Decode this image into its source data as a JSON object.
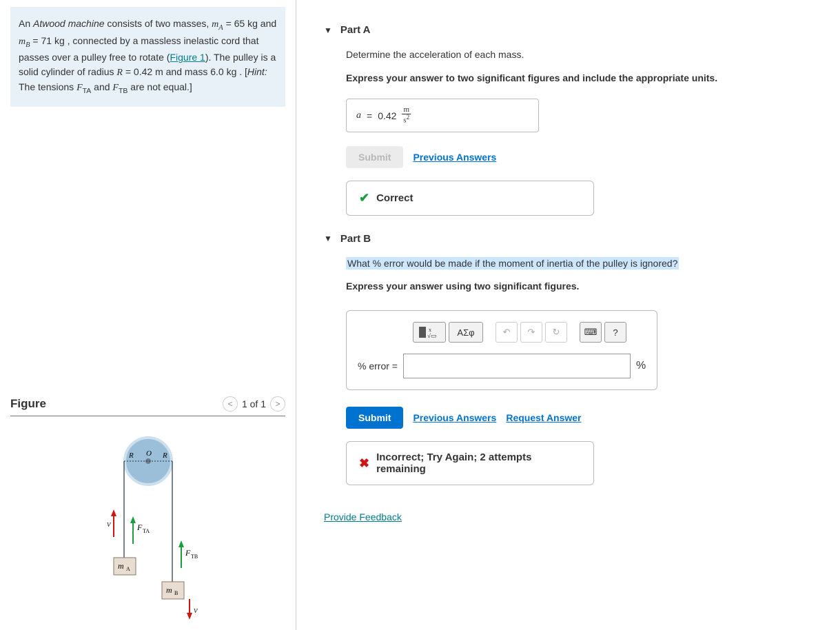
{
  "problem": {
    "text_intro": "An ",
    "machine_name": "Atwood machine",
    "text1": " consists of two masses, ",
    "mA_label": "m",
    "mA_sub": "A",
    "mA_eq": " = 65 ",
    "mA_unit": "kg",
    "text2": " and ",
    "mB_label": "m",
    "mB_sub": "B",
    "mB_eq": " = 71 ",
    "mB_unit": "kg",
    "text3": " , connected by a massless inelastic cord that passes over a pulley free to rotate (",
    "figure_link": "Figure 1",
    "text4": "). The pulley is a solid cylinder of radius ",
    "R_label": "R",
    "R_eq": " = 0.42 ",
    "R_unit": "m",
    "text5": " and mass 6.0 ",
    "mp_unit": "kg",
    "text6": " . [",
    "hint_label": "Hint:",
    "hint_text": " The tensions ",
    "FTA": "F",
    "FTA_sub": "TA",
    "and": " and ",
    "FTB": "F",
    "FTB_sub": "TB",
    "text7": " are not equal.]"
  },
  "figure": {
    "heading": "Figure",
    "pager_text": "1 of 1",
    "labels": {
      "R": "R",
      "O": "O",
      "v": "v",
      "FTA": "F",
      "FTA_sub": "TA",
      "FTB": "F",
      "FTB_sub": "TB",
      "mA": "m",
      "mA_sub": "A",
      "mB": "m",
      "mB_sub": "B"
    }
  },
  "partA": {
    "title": "Part A",
    "instruction": "Determine the acceleration of each mass.",
    "sub_instruction": "Express your answer to two significant figures and include the appropriate units.",
    "var": "a",
    "eq": " = ",
    "value": "0.42",
    "unit_num": "m",
    "unit_den": "s",
    "unit_den_exp": "2",
    "submit": "Submit",
    "prev": "Previous Answers",
    "feedback": "Correct"
  },
  "partB": {
    "title": "Part B",
    "question": "What % error would be made if the moment of inertia of the pulley is ignored?",
    "sub_instruction": "Express your answer using two significant figures.",
    "label": "% error = ",
    "unit": "%",
    "submit": "Submit",
    "prev": "Previous Answers",
    "req": "Request Answer",
    "feedback": "Incorrect; Try Again; 2 attempts remaining",
    "toolbar": {
      "templates": "√",
      "symbols": "ΑΣφ",
      "undo": "↶",
      "redo": "↷",
      "reset": "↻",
      "keyboard": "⌨",
      "help": "?"
    }
  },
  "footer": {
    "feedback_link": "Provide Feedback"
  }
}
